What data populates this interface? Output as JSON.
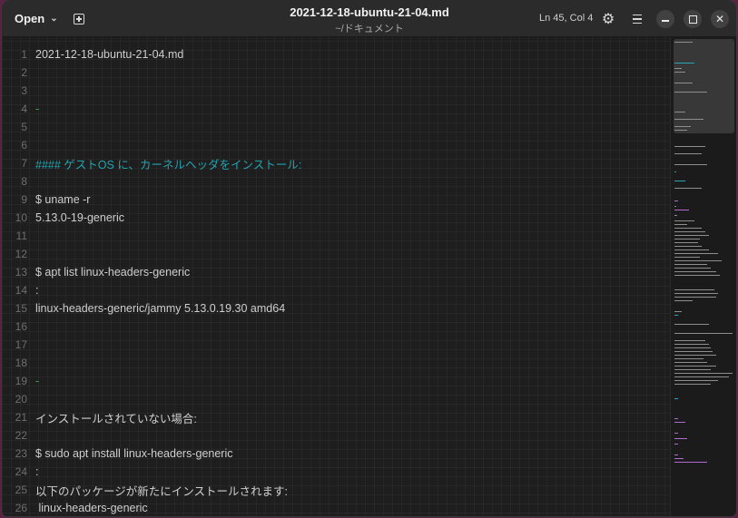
{
  "titlebar": {
    "open_label": "Open",
    "open_chevron": "⌄",
    "new_tab_icon": "new-tab-icon",
    "file_name": "2021-12-18-ubuntu-21-04.md",
    "file_path": "~/ドキュメント",
    "cursor_position": "Ln 45, Col  4",
    "settings_icon": "gear-icon",
    "menu_icon": "hamburger-menu-icon",
    "minimize_icon": "minimize-icon",
    "maximize_icon": "maximize-icon",
    "close_icon": "close-icon",
    "close_glyph": "✕"
  },
  "editor": {
    "lines": [
      {
        "num": "1",
        "text": "2021-12-18-ubuntu-21-04.md",
        "kind": "normal"
      },
      {
        "num": "2",
        "text": "",
        "kind": "normal"
      },
      {
        "num": "3",
        "text": "",
        "kind": "normal"
      },
      {
        "num": "4",
        "text": "-",
        "kind": "hr"
      },
      {
        "num": "5",
        "text": "",
        "kind": "normal"
      },
      {
        "num": "6",
        "text": "",
        "kind": "normal"
      },
      {
        "num": "7",
        "text": "#### ゲストOS に、カーネルヘッダをインストール:",
        "kind": "heading"
      },
      {
        "num": "8",
        "text": "",
        "kind": "normal"
      },
      {
        "num": "9",
        "text": "$ uname -r",
        "kind": "normal"
      },
      {
        "num": "10",
        "text": "5.13.0-19-generic",
        "kind": "normal"
      },
      {
        "num": "11",
        "text": "",
        "kind": "normal"
      },
      {
        "num": "12",
        "text": "",
        "kind": "normal"
      },
      {
        "num": "13",
        "text": "$ apt list linux-headers-generic",
        "kind": "normal"
      },
      {
        "num": "14",
        "text": ":",
        "kind": "normal"
      },
      {
        "num": "15",
        "text": "linux-headers-generic/jammy 5.13.0.19.30 amd64",
        "kind": "normal"
      },
      {
        "num": "16",
        "text": "",
        "kind": "normal"
      },
      {
        "num": "17",
        "text": "",
        "kind": "normal"
      },
      {
        "num": "18",
        "text": "",
        "kind": "normal"
      },
      {
        "num": "19",
        "text": "-",
        "kind": "hr"
      },
      {
        "num": "20",
        "text": "",
        "kind": "normal"
      },
      {
        "num": "21",
        "text": "インストールされていない場合:",
        "kind": "normal"
      },
      {
        "num": "22",
        "text": "",
        "kind": "normal"
      },
      {
        "num": "23",
        "text": "$ sudo apt install linux-headers-generic",
        "kind": "normal"
      },
      {
        "num": "24",
        "text": ":",
        "kind": "normal"
      },
      {
        "num": "25",
        "text": "以下のパッケージが新たにインストールされます:",
        "kind": "normal"
      },
      {
        "num": "26",
        "text": " linux-headers-generic",
        "kind": "normal"
      }
    ]
  },
  "minimap": {
    "colors": {
      "text": "#8d8d8d",
      "heading": "#2aa7b4",
      "hr": "#4aa060",
      "accent": "#b06bd0"
    }
  },
  "colors": {
    "desktop": "#5b2143",
    "editor_bg": "#1e1e1e",
    "titlebar_bg": "#2b2b2b",
    "line_number": "#6f6f6f",
    "text": "#cfcfcf",
    "heading": "#22a3b0",
    "hr": "#4aa060"
  }
}
